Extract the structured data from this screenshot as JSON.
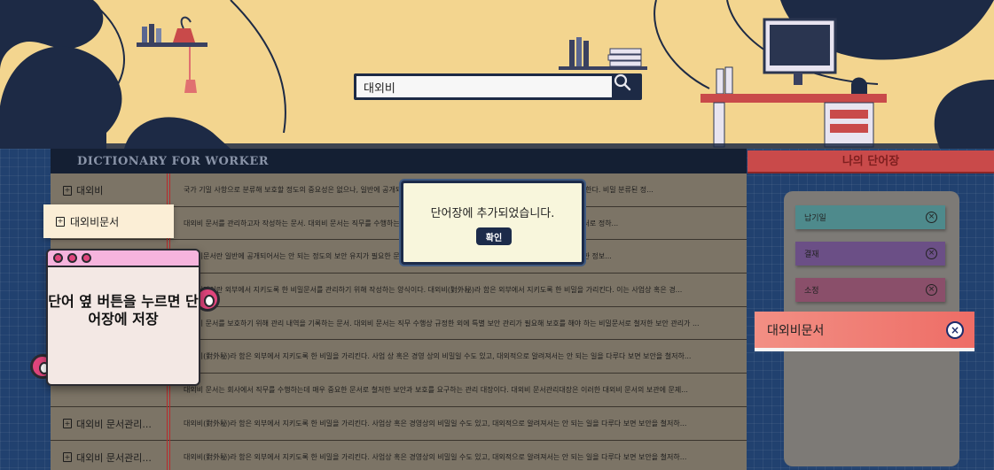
{
  "search": {
    "value": "대외비"
  },
  "dictionary": {
    "title": "DICTIONARY FOR WORKER",
    "rows": [
      {
        "term": "대외비",
        "desc": "국가 기밀 사항으로 분류해 보호할 정도의 중요성은 없으나, 일반에 공개되어서는 안 되는 정도의 보안을 요구하는 수준의 정보 분류를 말한다. 비밀 분류된 정..."
      },
      {
        "term": "",
        "desc": "대외비 문서를 관리하고자 작성하는 문서. 대외비 문서는 직무를 수행하는데 매우 중요한 문서로 철저한 보안 관리가 필요한 경우 비밀문서로 정하..."
      },
      {
        "term": "",
        "desc": "대외비문서란 일반에 공개되어서는 안 되는 정도의 보안 유지가 필요한 문서로서, 일반에 공개되어서는 안 되는 정도의 보안 유지가 필요한 정보..."
      },
      {
        "term": "",
        "desc": "대외비장이란 외부에서 지키도록 한 비밀문서를 관리하기 위해 작성하는 양식이다. 대외비(對外秘)라 함은 외부에서 지키도록 한 비밀을 가리킨다. 이는 사업상 혹은 경..."
      },
      {
        "term": "",
        "desc": "대외비 문서를 보호하기 위해 관리 내역을 기록하는 문서. 대외비 문서는 직무 수행상 규정한 외에 특별 보안 관리가 필요해 보호를 해야 하는 비밀문서로 철저한 보안 관리가 ..."
      },
      {
        "term": "",
        "desc": "대외비(對外秘)라 함은 외부에서 지키도록 한 비밀을 가리킨다. 사업 상 혹은 경영 상의 비밀일 수도 있고, 대외적으로 알려져서는 안 되는 일을 다루다 보면 보안을 철저하..."
      },
      {
        "term": "",
        "desc": "대외비 문서는 회사에서 직무를 수행하는데 매우 중요한 문서로 철저한 보안과 보호를 요구하는 관리 대장이다. 대외비 문서관리대장은 이러한 대외비 문서의 보관에 문제..."
      },
      {
        "term": "대외비 문서관리...",
        "desc": "대외비(對外秘)라 함은 외부에서 지키도록 한 비밀을 가리킨다. 사업상 혹은 경영상의 비밀일 수도 있고, 대외적으로 알려져서는 안 되는 일을 다루다 보면 보안을 철저하..."
      },
      {
        "term": "대외비 문서관리...",
        "desc": "대외비(對外秘)라 함은 외부에서 지키도록 한 비밀을 가리킨다. 사업상 혹은 경영상의 비밀일 수도 있고, 대외적으로 알려져서는 안 되는 일을 다루다 보면 보안을 철저하..."
      }
    ],
    "highlight_term": "대외비문서"
  },
  "hint": {
    "text": "단어 옆 버튼을 누르면 단어장에 저장"
  },
  "modal": {
    "message": "단어장에 추가되었습니다.",
    "ok_label": "확인"
  },
  "vocab": {
    "title": "나의 단어장",
    "items": [
      {
        "label": "납기일",
        "color": "#4e8a8c"
      },
      {
        "label": "결재",
        "color": "#6b4f86"
      },
      {
        "label": "소정",
        "color": "#8a4f6a"
      }
    ],
    "new_item": "대외비문서"
  }
}
